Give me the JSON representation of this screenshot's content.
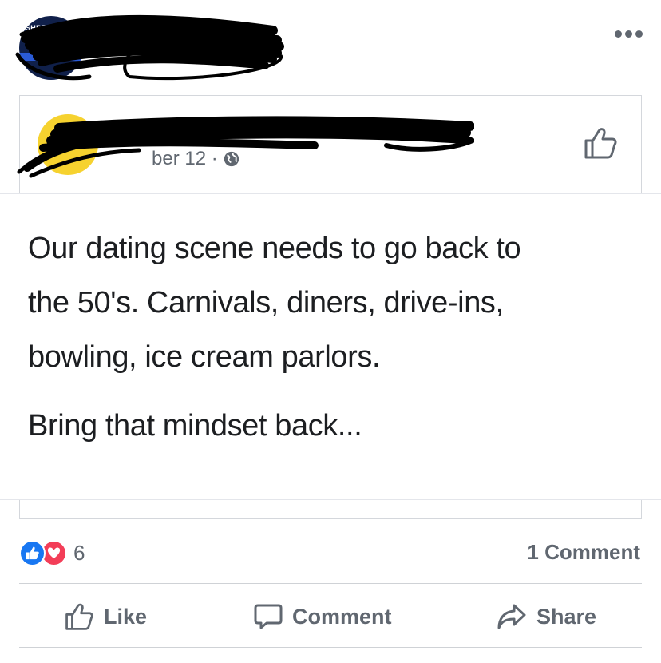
{
  "header": {
    "avatar_badge_text": "SHREVEPORT POLICE",
    "more_icon": "more-horizontal-icon"
  },
  "shared_post": {
    "meta_date": "ber 12 ·",
    "privacy_icon": "globe-icon",
    "like_icon": "thumbs-up-outline-icon"
  },
  "status": {
    "lines": [
      "Our dating scene needs to go back to",
      "the 50's. Carnivals, diners, drive-ins,",
      "bowling, ice cream parlors.",
      "Bring that mindset back..."
    ]
  },
  "reactions": {
    "types": [
      "like-reaction-icon",
      "love-reaction-icon"
    ],
    "count": "6",
    "comments": "1 Comment"
  },
  "actions": {
    "like": "Like",
    "comment": "Comment",
    "share": "Share"
  },
  "colors": {
    "like_blue": "#1877f2",
    "love_red": "#f33e58",
    "secondary_text": "#606770"
  }
}
